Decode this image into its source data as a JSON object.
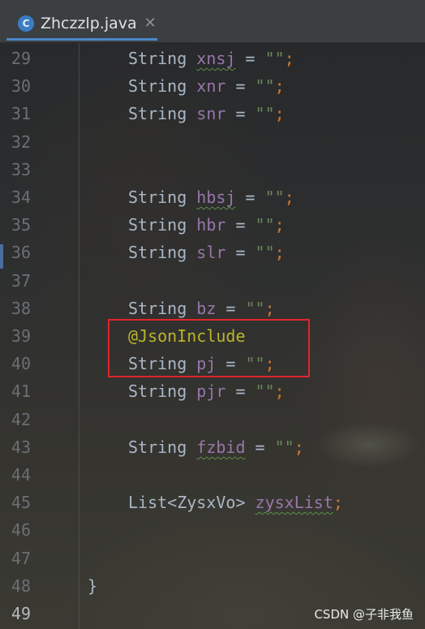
{
  "tab": {
    "icon_letter": "C",
    "filename": "Zhczzlp.java",
    "close_glyph": "✕"
  },
  "code_lines": [
    {
      "n": "29",
      "type": "decl",
      "kw": "String",
      "var": "xnsj",
      "op": " = ",
      "str": "\"\"",
      "semi": ";"
    },
    {
      "n": "30",
      "type": "decl",
      "kw": "String",
      "var": "xnr",
      "op": " = ",
      "str": "\"\"",
      "semi": ";"
    },
    {
      "n": "31",
      "type": "decl",
      "kw": "String",
      "var": "snr",
      "op": " = ",
      "str": "\"\"",
      "semi": ";"
    },
    {
      "n": "32",
      "type": "blank"
    },
    {
      "n": "33",
      "type": "blank"
    },
    {
      "n": "34",
      "type": "decl",
      "kw": "String",
      "var": "hbsj",
      "op": " = ",
      "str": "\"\"",
      "semi": ";"
    },
    {
      "n": "35",
      "type": "decl",
      "kw": "String",
      "var": "hbr",
      "op": " = ",
      "str": "\"\"",
      "semi": ";"
    },
    {
      "n": "36",
      "type": "decl",
      "kw": "String",
      "var": "slr",
      "op": " = ",
      "str": "\"\"",
      "semi": ";"
    },
    {
      "n": "37",
      "type": "blank"
    },
    {
      "n": "38",
      "type": "decl",
      "kw": "String",
      "var": "bz",
      "op": " = ",
      "str": "\"\"",
      "semi": ";"
    },
    {
      "n": "39",
      "type": "annotation",
      "text": "@JsonInclude"
    },
    {
      "n": "40",
      "type": "decl",
      "kw": "String",
      "var": "pj",
      "op": " = ",
      "str": "\"\"",
      "semi": ";"
    },
    {
      "n": "41",
      "type": "decl",
      "kw": "String",
      "var": "pjr",
      "op": " = ",
      "str": "\"\"",
      "semi": ";"
    },
    {
      "n": "42",
      "type": "blank"
    },
    {
      "n": "43",
      "type": "decl",
      "kw": "String",
      "var": "fzbid",
      "op": " = ",
      "str": "\"\"",
      "semi": ";"
    },
    {
      "n": "44",
      "type": "blank"
    },
    {
      "n": "45",
      "type": "decl",
      "kw": "List<ZysxVo>",
      "var": "zysxList",
      "op": "",
      "str": "",
      "semi": ";"
    },
    {
      "n": "46",
      "type": "blank"
    },
    {
      "n": "47",
      "type": "blank"
    },
    {
      "n": "48",
      "type": "brace",
      "text": "}"
    },
    {
      "n": "49",
      "type": "blank",
      "current": true
    }
  ],
  "highlight_color": "#e2242b",
  "watermark": "CSDN @子非我鱼"
}
